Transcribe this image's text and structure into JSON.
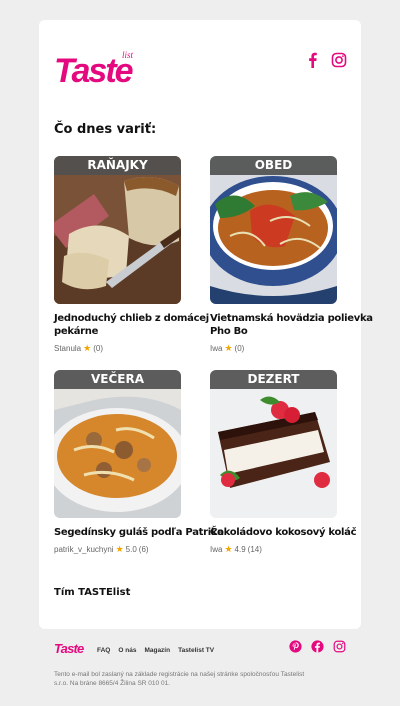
{
  "brand": {
    "name": "Taste",
    "tagline": "list",
    "color": "#e5097f"
  },
  "heading": "Čo dnes variť:",
  "recipes": [
    {
      "category": "RAŇAJKY",
      "title_line1": "Jednoduchý chlieb z domácej",
      "title_line2": "pekárne",
      "author": "Stanula",
      "rating": "",
      "reviews": "(0)",
      "image": "bread"
    },
    {
      "category": "OBED",
      "title_line1": "Vietnamská hovädzia polievka",
      "title_line2": "Pho Bo",
      "author": "Iwa",
      "rating": "",
      "reviews": "(0)",
      "image": "pho-soup"
    },
    {
      "category": "VEČERA",
      "title_line1": "Segedínsky guláš podľa Patrika",
      "title_line2": "",
      "author": "patrik_v_kuchyni",
      "rating": "5.0",
      "reviews": "(6)",
      "image": "goulash"
    },
    {
      "category": "DEZERT",
      "title_line1": "Čokoládovo kokosový koláč",
      "title_line2": "",
      "author": "Iwa",
      "rating": "4.9",
      "reviews": "(14)",
      "image": "chocolate-cake"
    }
  ],
  "signature": "Tím TASTElist",
  "footer": {
    "links": [
      "FAQ",
      "O nás",
      "Magazín",
      "Tastelist TV"
    ],
    "social": [
      "pinterest-icon",
      "facebook-icon",
      "instagram-icon"
    ],
    "disclaimer": "Tento e-mail bol zaslaný na základe registrácie na našej stránke spoločnosťou Tastelist s.r.o. Na bráne 8665/4 Žilina SR 010 01."
  }
}
